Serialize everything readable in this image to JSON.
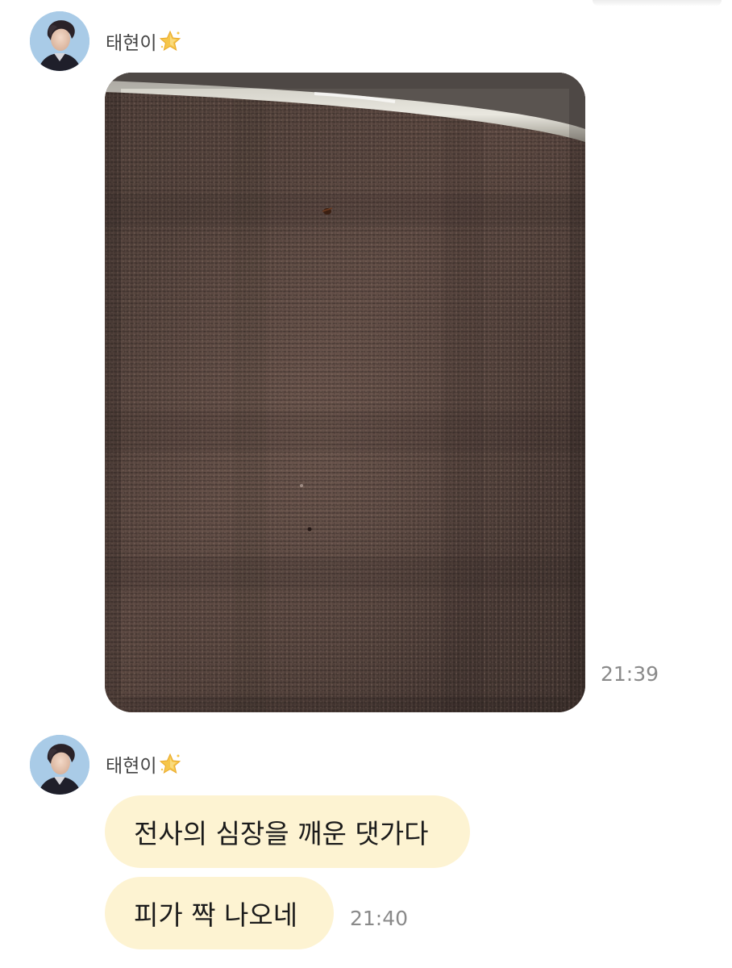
{
  "conversation": {
    "groups": [
      {
        "sender": "태현이",
        "sender_badge_icon": "star-icon",
        "photo": {
          "description_icon": "photo-attachment",
          "time": "21:39"
        }
      },
      {
        "sender": "태현이",
        "sender_badge_icon": "star-icon",
        "messages": [
          {
            "text": "전사의 심장을 깨운 댓가다"
          },
          {
            "text": "피가 짝 나오네",
            "time": "21:40"
          }
        ]
      }
    ]
  },
  "colors": {
    "bubble_background": "#fdf3d2",
    "time_text": "#8a8a8a",
    "name_text": "#444444",
    "star_badge": "#f6c64a"
  }
}
